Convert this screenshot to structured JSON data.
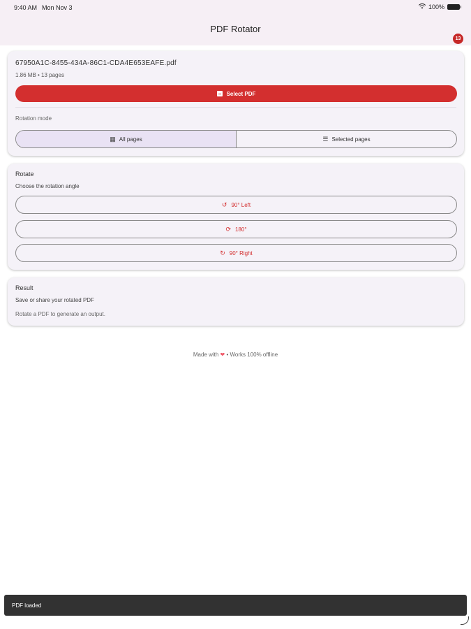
{
  "status_bar": {
    "time": "9:40 AM",
    "date": "Mon Nov 3",
    "battery": "100%"
  },
  "app_bar": {
    "title": "PDF Rotator",
    "badge_count": "13"
  },
  "file_card": {
    "filename": "67950A1C-8455-434A-86C1-CDA4E653EAFE.pdf",
    "info": "1.86 MB • 13 pages",
    "select_label": "Select PDF",
    "mode_label": "Rotation mode",
    "modes": [
      {
        "label": "All pages",
        "icon": "grid-icon",
        "selected": true
      },
      {
        "label": "Selected pages",
        "icon": "checklist-icon",
        "selected": false
      }
    ]
  },
  "rotate_card": {
    "title": "Rotate",
    "subtitle": "Choose the rotation angle",
    "buttons": [
      {
        "label": "90° Left",
        "icon": "rotate-left-icon"
      },
      {
        "label": "180°",
        "icon": "rotate-180-icon"
      },
      {
        "label": "90° Right",
        "icon": "rotate-right-icon"
      }
    ]
  },
  "result_card": {
    "title": "Result",
    "subtitle": "Save or share your rotated PDF",
    "hint": "Rotate a PDF to generate an output."
  },
  "footer": {
    "prefix": "Made with",
    "suffix": "• Works 100% offline"
  },
  "snackbar": {
    "message": "PDF loaded"
  },
  "colors": {
    "accent": "#d32f2f",
    "surface": "#f5f2f8",
    "appbar": "#f6eff5",
    "selected_segment": "#e9e2f4"
  }
}
